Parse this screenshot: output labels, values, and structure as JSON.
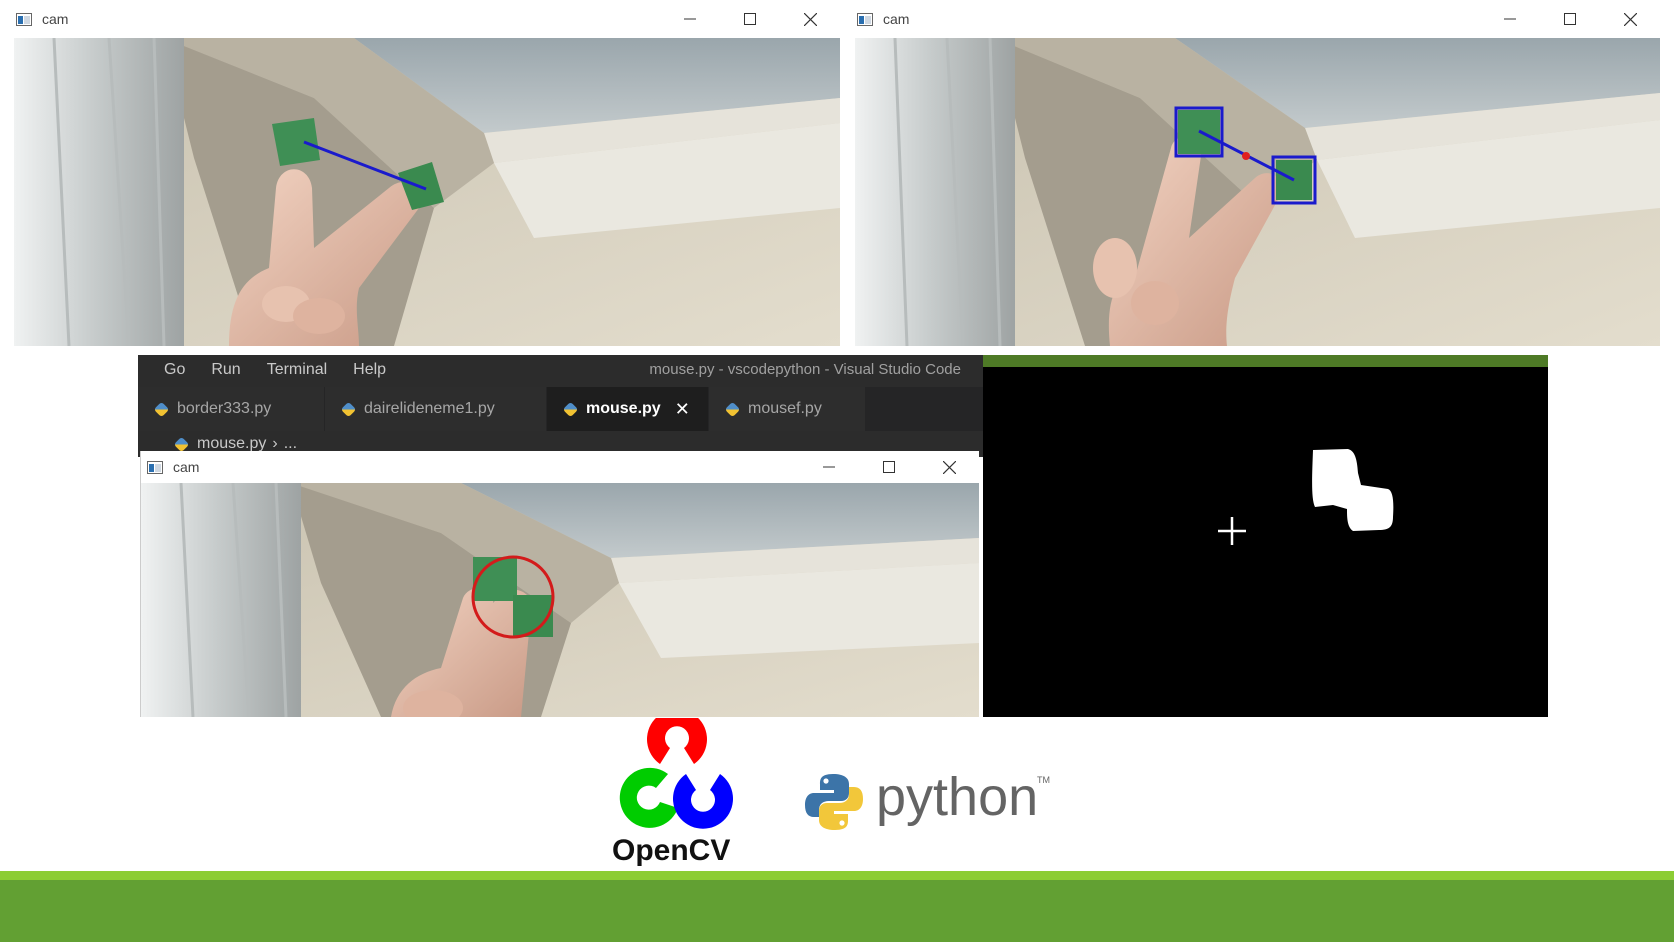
{
  "windows": {
    "cam1": {
      "title": "cam"
    },
    "cam2": {
      "title": "cam"
    },
    "cam3": {
      "title": "cam"
    }
  },
  "vscode": {
    "menu": [
      "Go",
      "Run",
      "Terminal",
      "Help"
    ],
    "window_title": "mouse.py - vscodepython - Visual Studio Code",
    "tabs": [
      {
        "label": "border333.py",
        "active": false
      },
      {
        "label": "dairelideneme1.py",
        "active": false
      },
      {
        "label": "mouse.py",
        "active": true
      },
      {
        "label": "mousef.py",
        "active": false
      }
    ],
    "breadcrumb": "mouse.py",
    "breadcrumb_rest": "..."
  },
  "logos": {
    "opencv": "OpenCV",
    "python": "python",
    "python_tm": "TM"
  },
  "icons": [
    "app-window-icon",
    "minimize-icon",
    "maximize-icon",
    "close-icon",
    "python-file-icon",
    "chevron-right-icon",
    "crosshair-icon",
    "opencv-logo",
    "python-logo"
  ],
  "colors": {
    "footer": "#62a033",
    "footer_highlight": "#8ccd34",
    "vscode_bg": "#2c2c2c",
    "marker_green": "#3f8f55",
    "track_line": "#1a1acc",
    "detect_circle": "#d31b1b"
  }
}
